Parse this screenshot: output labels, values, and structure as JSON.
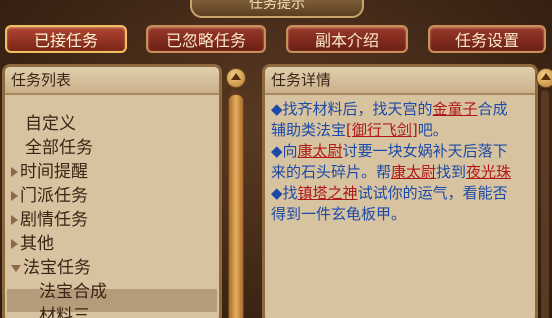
{
  "window": {
    "title": "任务提示"
  },
  "tabs": [
    {
      "label": "已接任务",
      "active": true
    },
    {
      "label": "已忽略任务",
      "active": false
    },
    {
      "label": "副本介绍",
      "active": false
    },
    {
      "label": "任务设置",
      "active": false
    }
  ],
  "task_list": {
    "title": "任务列表",
    "items": [
      {
        "label": "自定义",
        "indent": 1,
        "arrow": "none"
      },
      {
        "label": "全部任务",
        "indent": 1,
        "arrow": "none"
      },
      {
        "label": "时间提醒",
        "indent": 0,
        "arrow": "right"
      },
      {
        "label": "门派任务",
        "indent": 0,
        "arrow": "right"
      },
      {
        "label": "剧情任务",
        "indent": 0,
        "arrow": "right"
      },
      {
        "label": "其他",
        "indent": 0,
        "arrow": "right"
      },
      {
        "label": "法宝任务",
        "indent": 0,
        "arrow": "down",
        "selected": true
      },
      {
        "label": "法宝合成",
        "indent": 2,
        "arrow": "none"
      },
      {
        "label": "材料三",
        "indent": 2,
        "arrow": "none"
      }
    ]
  },
  "task_detail": {
    "title": "任务详情",
    "paragraphs": [
      {
        "segments": [
          {
            "text": "◆找齐材料后，找天宫的",
            "hl": false
          },
          {
            "text": "金童子",
            "hl": true
          },
          {
            "text": "合成辅助类法宝",
            "hl": false
          },
          {
            "text": "[御行飞剑]",
            "hl": true
          },
          {
            "text": "吧。",
            "hl": false
          }
        ]
      },
      {
        "segments": [
          {
            "text": "◆向",
            "hl": false
          },
          {
            "text": "康太尉",
            "hl": true
          },
          {
            "text": "讨要一块女娲补天后落下来的石头碎片。帮",
            "hl": false
          },
          {
            "text": "康太尉",
            "hl": true
          },
          {
            "text": "找到",
            "hl": false
          },
          {
            "text": "夜光珠",
            "hl": true
          }
        ]
      },
      {
        "segments": [
          {
            "text": "◆找",
            "hl": false
          },
          {
            "text": "镇塔之神",
            "hl": true
          },
          {
            "text": "试试你的运气，看能否得到一件玄龟板甲。",
            "hl": false
          }
        ]
      }
    ]
  },
  "colors": {
    "tab_bg": "#8a2a1c",
    "panel_bg": "#d8c3a0",
    "link": "#b01818",
    "body_text": "#1c4aa8"
  }
}
